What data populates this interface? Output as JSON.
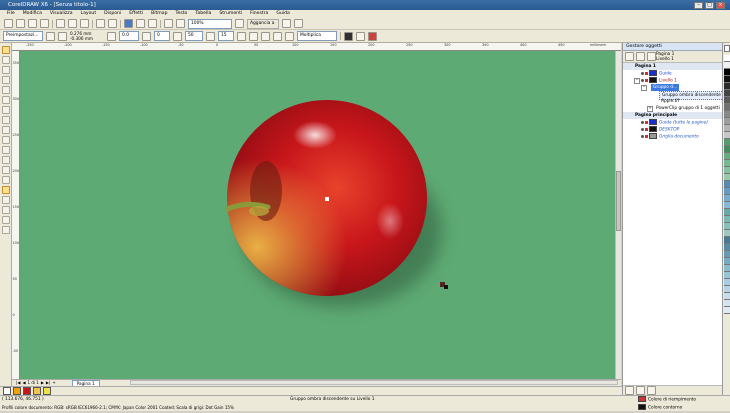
{
  "window": {
    "title": "CorelDRAW X6 - [Senza titolo-1]"
  },
  "menu": [
    "File",
    "Modifica",
    "Visualizza",
    "Layout",
    "Disponi",
    "Effetti",
    "Bitmap",
    "Testo",
    "Tabella",
    "Strumenti",
    "Finestra",
    "Guida"
  ],
  "toolbar1": {
    "zoom": "100%",
    "snap_label": "Aggancia a"
  },
  "toolbar2": {
    "preset": "Preimpostazi...",
    "x": "0.276 mm",
    "y": "-0.306 mm",
    "w": "0.0",
    "h": "0",
    "opacity": "50",
    "feather": "15",
    "blend_mode": "Moltiplica"
  },
  "ruler": {
    "h_ticks": [
      "-250",
      "-200",
      "-150",
      "-100",
      "-50",
      "0",
      "50",
      "100",
      "150",
      "200",
      "250",
      "300",
      "350",
      "400",
      "450",
      "500"
    ],
    "h_unit": "millimetri",
    "v_ticks": [
      "350",
      "300",
      "250",
      "200",
      "150",
      "100",
      "50",
      "0",
      "-50"
    ]
  },
  "pagenav": {
    "counter": "1 di 1",
    "page_tab": "Pagina 1"
  },
  "statusbar": {
    "coords": "( 113.676, 46.751 )",
    "center": "Gruppo ombra discendente su Livello 1",
    "profile": "Profili colore documento: RGB: sRGB IEC61966-2.1; CMYK: Japan Color 2001 Coated; Scala di grigi: Dot Gain 15%",
    "fill_label": "Colore di riempimento",
    "stroke_label": "Colore contorno"
  },
  "docker": {
    "title": "Gestore oggetti",
    "page_info": [
      "Pagina 1",
      "Livello 1"
    ],
    "tree": {
      "page1": "Pagina 1",
      "guides": "Guide",
      "layer1": "Livello 1",
      "group": "Gruppo d...",
      "shadow": "Gruppo ombra discendente",
      "apple": "Apple.tif",
      "powerclip": "PowerClip gruppo di 1 oggetti",
      "master": "Pagina principale",
      "guides_all": "Guide (tutte le pagine)",
      "desktop": "DESKTOP",
      "grid": "Griglia documento"
    }
  },
  "colors": {
    "canvas": "#5eaa74",
    "selection": "#3d7ae0",
    "apple_red": "#c8161b",
    "apple_yellow": "#f2c24a"
  },
  "icons": [
    "pick-tool-icon",
    "shape-tool-icon",
    "crop-tool-icon",
    "zoom-tool-icon",
    "freehand-tool-icon",
    "rectangle-tool-icon",
    "ellipse-tool-icon",
    "polygon-tool-icon",
    "text-tool-icon",
    "table-tool-icon",
    "dimension-tool-icon",
    "connector-tool-icon",
    "shadow-tool-icon",
    "eyedropper-tool-icon",
    "fill-tool-icon",
    "smart-fill-tool-icon"
  ]
}
